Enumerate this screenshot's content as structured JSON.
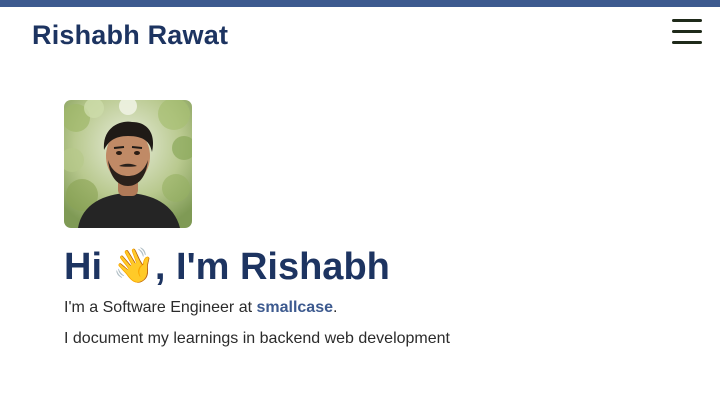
{
  "header": {
    "site_title": "Rishabh Rawat",
    "menu_icon": "hamburger-menu-icon"
  },
  "hero": {
    "greeting_before": "Hi ",
    "wave_emoji": "👋",
    "greeting_after": ", I'm Rishabh",
    "intro_prefix": "I'm a Software Engineer at ",
    "company": "smallcase",
    "intro_suffix": ".",
    "tagline": "I document my learnings in backend web development"
  },
  "colors": {
    "accent": "#3d5a8f",
    "heading": "#1d3461",
    "menu_bars": "#1f2a1a"
  }
}
